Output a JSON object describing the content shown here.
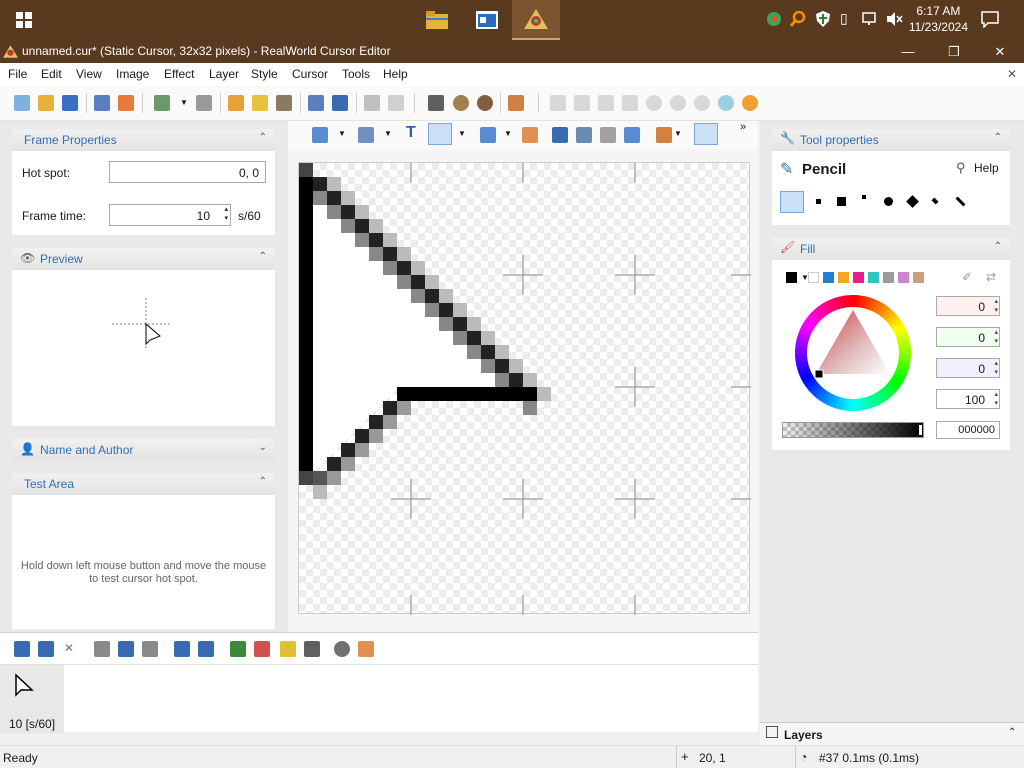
{
  "taskbar": {
    "clock_time": "6:17 AM",
    "clock_date": "11/23/2024"
  },
  "window": {
    "title": "unnamed.cur* (Static Cursor, 32x32 pixels) - RealWorld Cursor Editor",
    "minimize": "—",
    "maximize": "❐",
    "close": "✕"
  },
  "menu": [
    "File",
    "Edit",
    "View",
    "Image",
    "Effect",
    "Layer",
    "Style",
    "Cursor",
    "Tools",
    "Help"
  ],
  "menu_close": "✕",
  "left": {
    "frame_properties": {
      "title": "Frame Properties",
      "hotspot_label": "Hot spot:",
      "hotspot_value": "0, 0",
      "frametime_label": "Frame time:",
      "frametime_value": "10",
      "frametime_unit": "s/60"
    },
    "preview": {
      "title": "Preview"
    },
    "name_author": {
      "title": "Name and Author"
    },
    "test_area": {
      "title": "Test Area",
      "text": "Hold down left mouse button and move the mouse to test cursor hot spot."
    }
  },
  "right": {
    "tool_properties": {
      "title": "Tool properties",
      "tool_name": "Pencil",
      "help_label": "Help"
    },
    "fill": {
      "title": "Fill",
      "swatches": [
        "#000000",
        "#ffffff",
        "#1e7fd6",
        "#f5a623",
        "#e91e8c",
        "#2ec4c4",
        "#9b9b9b",
        "#d084d0",
        "#c8a080"
      ],
      "spin_values": [
        "0",
        "0",
        "0",
        "100"
      ],
      "hex_value": "000000"
    },
    "layers": {
      "title": "Layers"
    }
  },
  "frames": {
    "frame_label": "10 [s/60]"
  },
  "status": {
    "ready": "Ready",
    "coords": "20, 1",
    "info": "#37 0.1ms (0.1ms)"
  },
  "colors": {
    "taskbar": "#5a3a1f",
    "accent_blue": "#2e6fb2",
    "panel_bg": "#e9e9e9"
  }
}
